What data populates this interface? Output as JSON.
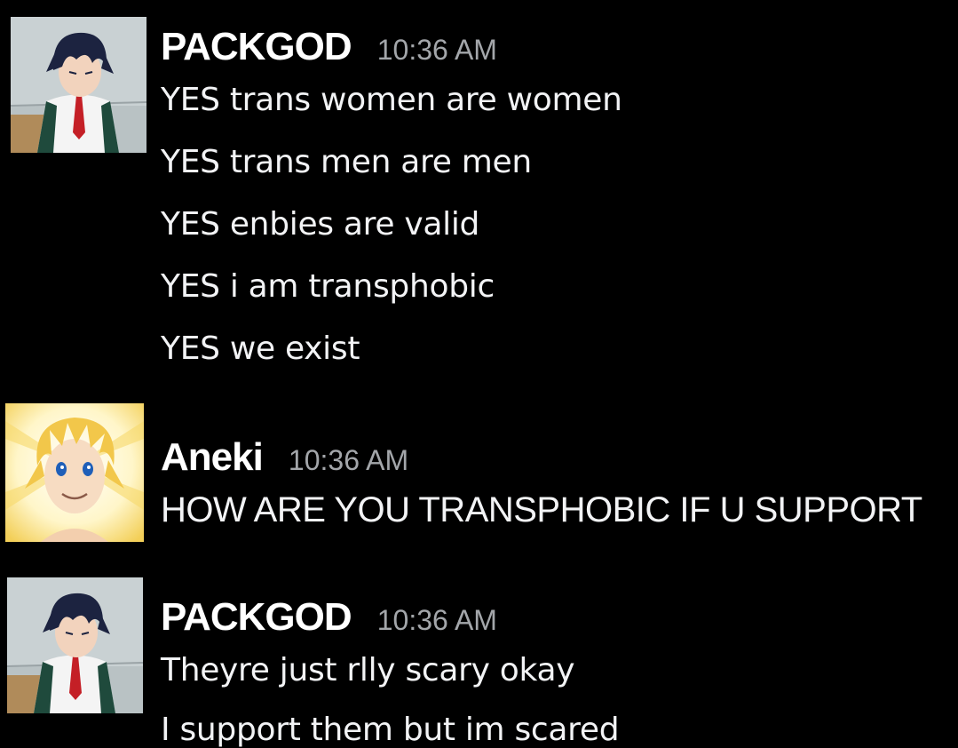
{
  "messages": [
    {
      "username": "PACKGOD",
      "timestamp": "10:36 AM",
      "avatar_icon": "anime-boy-dark-hair-avatar-icon",
      "lines": [
        "YES trans women are women",
        "YES trans men are men",
        "YES enbies are valid",
        "YES i am transphobic",
        "YES we exist"
      ]
    },
    {
      "username": "Aneki",
      "timestamp": "10:36 AM",
      "avatar_icon": "anime-boy-blond-hair-avatar-icon",
      "lines": [
        "HOW ARE YOU TRANSPHOBIC IF U SUPPORT"
      ]
    },
    {
      "username": "PACKGOD",
      "timestamp": "10:36 AM",
      "avatar_icon": "anime-boy-dark-hair-avatar-icon",
      "lines": [
        "Theyre just rlly scary okay",
        "I support them but im scared"
      ]
    }
  ],
  "colors": {
    "background": "#000000",
    "username": "#ffffff",
    "timestamp": "#a3a6aa",
    "message_text": "#f2f3f5"
  }
}
